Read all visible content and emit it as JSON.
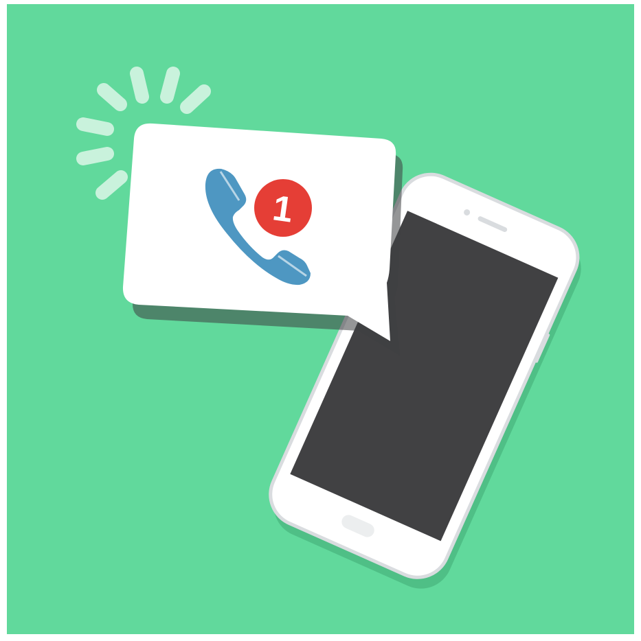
{
  "colors": {
    "page_border": "#ffffff",
    "background": "#61d99c",
    "shadow": "#4fbf86",
    "ring_rays": "#c9f2dc",
    "phone_body": "#ffffff",
    "phone_edge": "#d9dcdf",
    "phone_screen": "#414143",
    "bubble": "#ffffff",
    "handset": "#4e97c2",
    "badge": "#e53e36",
    "badge_text": "#ffffff"
  },
  "icons": {
    "notification": "phone-handset-icon",
    "rays": "ringing-rays-icon",
    "device": "smartphone-icon"
  },
  "notification": {
    "missed_calls_count": "1"
  }
}
